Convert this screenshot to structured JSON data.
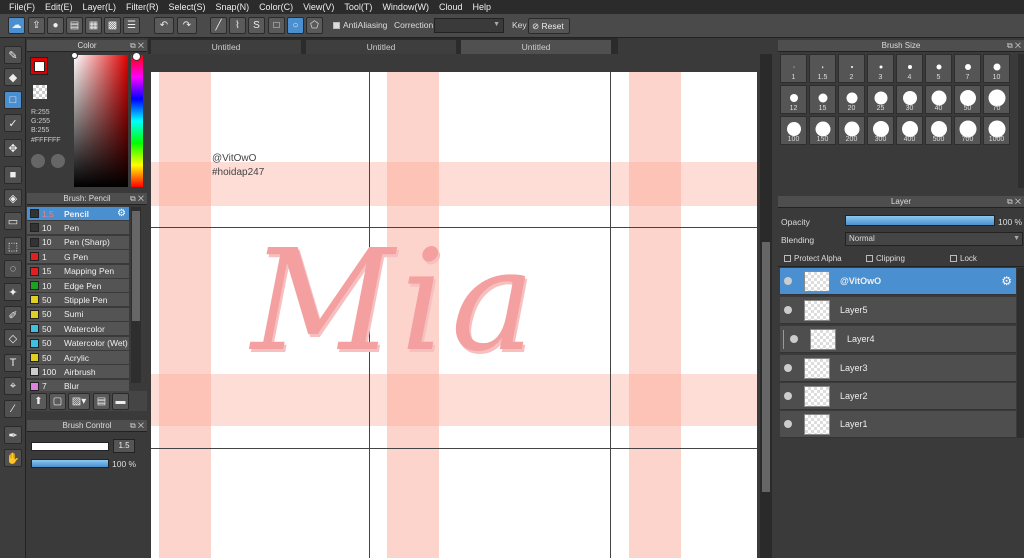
{
  "menu": [
    "File(F)",
    "Edit(E)",
    "Layer(L)",
    "Filter(R)",
    "Select(S)",
    "Snap(N)",
    "Color(C)",
    "View(V)",
    "Tool(T)",
    "Window(W)",
    "Cloud",
    "Help"
  ],
  "toolbar": {
    "antialiasing_label": "AntiAliasing",
    "correction_label": "Correction",
    "key_label": "Key",
    "reset_label": "Reset"
  },
  "color_panel": {
    "title": "Color",
    "r": "R:255",
    "g": "G:255",
    "b": "B:255",
    "hex": "#FFFFFF",
    "primary_color": "#ffffff",
    "secondary_color": "#e00000"
  },
  "brush_panel": {
    "title": "Brush: Pencil",
    "brushes": [
      {
        "size": "1.5",
        "name": "Pencil",
        "color": "#333333"
      },
      {
        "size": "10",
        "name": "Pen",
        "color": "#333333"
      },
      {
        "size": "10",
        "name": "Pen (Sharp)",
        "color": "#333333"
      },
      {
        "size": "1",
        "name": "G Pen",
        "color": "#e02020"
      },
      {
        "size": "15",
        "name": "Mapping Pen",
        "color": "#e02020"
      },
      {
        "size": "10",
        "name": "Edge Pen",
        "color": "#20a020"
      },
      {
        "size": "50",
        "name": "Stipple Pen",
        "color": "#e0d020"
      },
      {
        "size": "50",
        "name": "Sumi",
        "color": "#e0d020"
      },
      {
        "size": "50",
        "name": "Watercolor",
        "color": "#40c0e0"
      },
      {
        "size": "50",
        "name": "Watercolor (Wet)",
        "color": "#40c0e0"
      },
      {
        "size": "50",
        "name": "Acrylic",
        "color": "#e0d020"
      },
      {
        "size": "100",
        "name": "Airbrush",
        "color": "#cccccc"
      },
      {
        "size": "7",
        "name": "Blur",
        "color": "#e080e0"
      }
    ]
  },
  "brush_control": {
    "title": "Brush Control",
    "size": "1.5",
    "opacity": "100 %",
    "opacity_fraction": 1.0
  },
  "tabs": [
    "Untitled",
    "Untitled",
    "Untitled"
  ],
  "canvas": {
    "watermark_line1": "@VitOwO",
    "watermark_line2": "#hoidap247",
    "lettering": "Mia"
  },
  "brush_size": {
    "title": "Brush Size",
    "sizes": [
      "1",
      "1.5",
      "2",
      "3",
      "4",
      "5",
      "7",
      "10",
      "12",
      "15",
      "20",
      "25",
      "30",
      "40",
      "50",
      "70",
      "100",
      "150",
      "200",
      "300",
      "400",
      "500",
      "700",
      "1000"
    ]
  },
  "layer_panel": {
    "title": "Layer",
    "opacity_label": "Opacity",
    "opacity_value": "100 %",
    "opacity_fraction": 1.0,
    "blending_label": "Blending",
    "blending_value": "Normal",
    "protect_alpha": "Protect Alpha",
    "clipping": "Clipping",
    "lock": "Lock",
    "layers": [
      "@VitOwO",
      "Layer5",
      "Layer4",
      "Layer3",
      "Layer2",
      "Layer1"
    ]
  }
}
